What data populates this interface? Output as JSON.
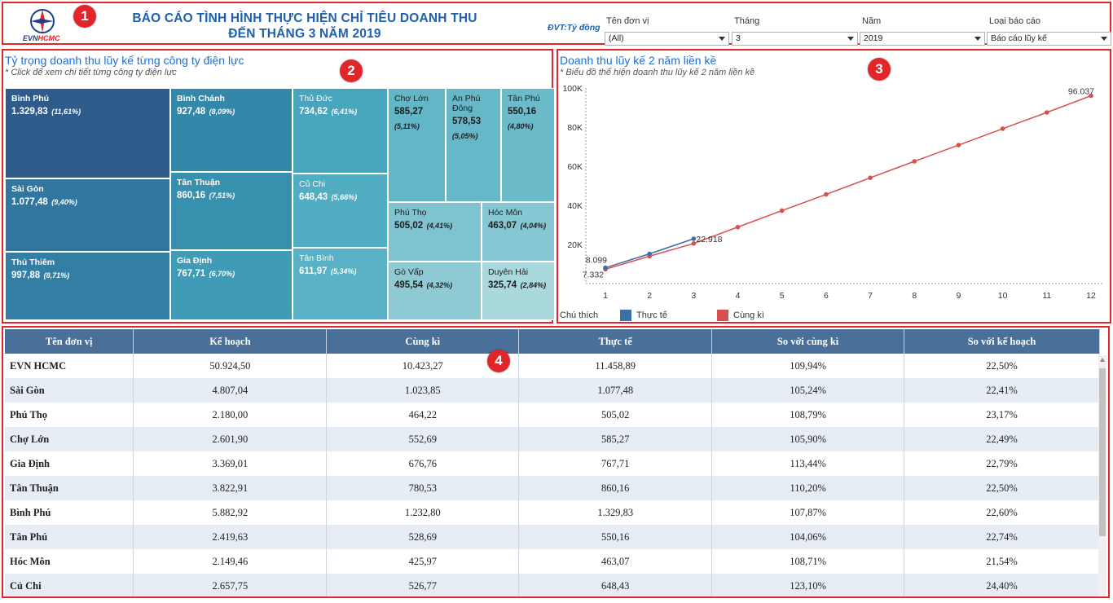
{
  "header": {
    "title_line1": "BÁO CÁO TÌNH HÌNH THỰC HIỆN CHỈ TIÊU DOANH THU",
    "title_line2": "ĐẾN THÁNG 3 NĂM 2019",
    "logo_evn": "EVN",
    "logo_hcmc": "HCMC",
    "unit": "ĐVT:Tỷ đồng",
    "badge": "1",
    "filters": [
      {
        "label": "Tên đơn vị",
        "value": "(All)"
      },
      {
        "label": "Tháng",
        "value": "3"
      },
      {
        "label": "Năm",
        "value": "2019"
      },
      {
        "label": "Loại báo cáo",
        "value": "Báo cáo lũy kế"
      }
    ]
  },
  "treemap": {
    "badge": "2",
    "title": "Tỷ trọng doanh thu lũy kế từng công ty điện lực",
    "subtitle": "* Click để xem chi tiết từng công ty điện lực",
    "cells": [
      {
        "name": "Bình Phú",
        "value": "1.329,83",
        "pct": "(11,61%)",
        "color": "#2e5b8a"
      },
      {
        "name": "Sài Gòn",
        "value": "1.077,48",
        "pct": "(9,40%)",
        "color": "#31769f"
      },
      {
        "name": "Thủ Thiêm",
        "value": "997,88",
        "pct": "(8,71%)",
        "color": "#327ea5"
      },
      {
        "name": "Bình Chánh",
        "value": "927,48",
        "pct": "(8,09%)",
        "color": "#3388aa"
      },
      {
        "name": "Tân Thuận",
        "value": "860,16",
        "pct": "(7,51%)",
        "color": "#3890af"
      },
      {
        "name": "Gia Định",
        "value": "767,71",
        "pct": "(6,70%)",
        "color": "#3f9bb6"
      },
      {
        "name": "Thủ Đức",
        "value": "734,62",
        "pct": "(6,41%)",
        "color": "#47a5bd"
      },
      {
        "name": "Củ Chi",
        "value": "648,43",
        "pct": "(5,66%)",
        "color": "#52adc2"
      },
      {
        "name": "Tân Bình",
        "value": "611,97",
        "pct": "(5,34%)",
        "color": "#58b1c5"
      },
      {
        "name": "Chợ Lớn",
        "value": "585,27",
        "pct": "(5,11%)",
        "color": "#62b6c8"
      },
      {
        "name": "An Phú Đông",
        "value": "578,53",
        "pct": "(5,05%)",
        "color": "#66b8c9"
      },
      {
        "name": "Tân Phú",
        "value": "550,16",
        "pct": "(4,80%)",
        "color": "#6cbbcb"
      },
      {
        "name": "Phú Thọ",
        "value": "505,02",
        "pct": "(4,41%)",
        "color": "#7ec3cf"
      },
      {
        "name": "Hóc Môn",
        "value": "463,07",
        "pct": "(4,04%)",
        "color": "#85c7d2"
      },
      {
        "name": "Gò Vấp",
        "value": "495,54",
        "pct": "(4,32%)",
        "color": "#8dcad4"
      },
      {
        "name": "Duyên Hải",
        "value": "325,74",
        "pct": "(2,84%)",
        "color": "#a9d8dd"
      }
    ]
  },
  "line_chart": {
    "badge": "3",
    "title": "Doanh thu lũy kế 2 năm liền kề",
    "subtitle": "* Biểu đồ thể hiện doanh thu lũy kế 2 năm liền kề",
    "legend_title": "Chú thích",
    "colors": {
      "actual": "#3b6fa8",
      "previous": "#d84f4f"
    }
  },
  "chart_data": {
    "type": "line",
    "title": "Doanh thu lũy kế 2 năm liền kề",
    "x": [
      1,
      2,
      3,
      4,
      5,
      6,
      7,
      8,
      9,
      10,
      11,
      12
    ],
    "xticks": [
      "1",
      "2",
      "3",
      "4",
      "5",
      "6",
      "7",
      "8",
      "9",
      "10",
      "11",
      "12"
    ],
    "yticks": [
      "20K",
      "40K",
      "60K",
      "80K",
      "100K"
    ],
    "ylim": [
      0,
      100000
    ],
    "series": [
      {
        "name": "Thực tế",
        "values": [
          8099,
          15200,
          22918
        ]
      },
      {
        "name": "Cùng kì",
        "values": [
          7332,
          14000,
          20500,
          28900,
          37300,
          45600,
          54100,
          62500,
          70800,
          79200,
          87500,
          96037
        ]
      }
    ],
    "point_labels": [
      {
        "series": 0,
        "index": 0,
        "text": "8.099"
      },
      {
        "series": 0,
        "index": 2,
        "text": "22.918"
      },
      {
        "series": 1,
        "index": 0,
        "text": "7.332"
      },
      {
        "series": 1,
        "index": 11,
        "text": "96.037"
      }
    ],
    "legend": "bottom-left"
  },
  "table": {
    "badge": "4",
    "headers": [
      "Tên đơn vị",
      "Kế hoạch",
      "Cùng kì",
      "Thực tế",
      "So với cùng kì",
      "So với kế hoạch"
    ],
    "rows": [
      [
        "EVN HCMC",
        "50.924,50",
        "10.423,27",
        "11.458,89",
        "109,94%",
        "22,50%"
      ],
      [
        "Sài Gòn",
        "4.807,04",
        "1.023,85",
        "1.077,48",
        "105,24%",
        "22,41%"
      ],
      [
        "Phú Thọ",
        "2.180,00",
        "464,22",
        "505,02",
        "108,79%",
        "23,17%"
      ],
      [
        "Chợ Lớn",
        "2.601,90",
        "552,69",
        "585,27",
        "105,90%",
        "22,49%"
      ],
      [
        "Gia Định",
        "3.369,01",
        "676,76",
        "767,71",
        "113,44%",
        "22,79%"
      ],
      [
        "Tân Thuận",
        "3.822,91",
        "780,53",
        "860,16",
        "110,20%",
        "22,50%"
      ],
      [
        "Bình Phú",
        "5.882,92",
        "1.232,80",
        "1.329,83",
        "107,87%",
        "22,60%"
      ],
      [
        "Tân Phú",
        "2.419,63",
        "528,69",
        "550,16",
        "104,06%",
        "22,74%"
      ],
      [
        "Hóc Môn",
        "2.149,46",
        "425,97",
        "463,07",
        "108,71%",
        "21,54%"
      ],
      [
        "Củ Chi",
        "2.657,75",
        "526,77",
        "648,43",
        "123,10%",
        "24,40%"
      ]
    ]
  }
}
